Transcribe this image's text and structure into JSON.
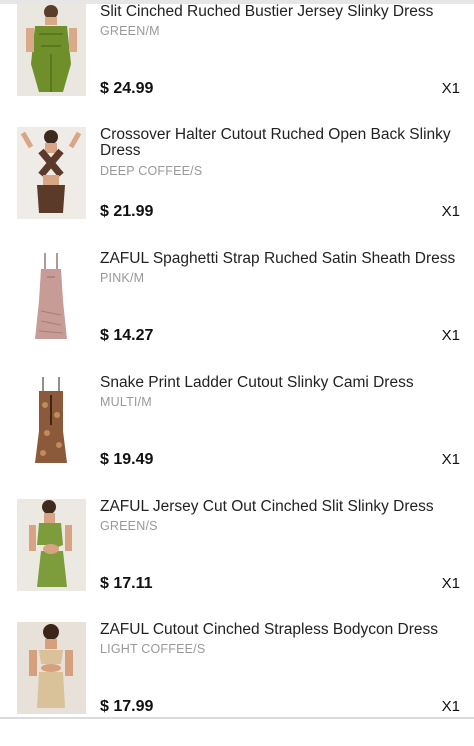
{
  "cart_items": [
    {
      "title": "Slit Cinched Ruched Bustier Jersey Slinky Dress",
      "variant": "GREEN/M",
      "price": "$ 24.99",
      "quantity": "X1",
      "image_color": "#6f8f2a"
    },
    {
      "title": "Crossover Halter Cutout Ruched Open Back Slinky Dress",
      "variant": "DEEP COFFEE/S",
      "price": "$ 21.99",
      "quantity": "X1",
      "image_color": "#5b3a2a"
    },
    {
      "title": "ZAFUL Spaghetti Strap Ruched Satin Sheath Dress",
      "variant": "PINK/M",
      "price": "$ 14.27",
      "quantity": "X1",
      "image_color": "#c89c96"
    },
    {
      "title": "Snake Print Ladder Cutout Slinky Cami Dress",
      "variant": "MULTI/M",
      "price": "$ 19.49",
      "quantity": "X1",
      "image_color": "#8a5a3a"
    },
    {
      "title": "ZAFUL Jersey Cut Out Cinched Slit Slinky Dress",
      "variant": "GREEN/S",
      "price": "$ 17.11",
      "quantity": "X1",
      "image_color": "#7d9d3c"
    },
    {
      "title": "ZAFUL Cutout Cinched Strapless Bodycon Dress",
      "variant": "LIGHT COFFEE/S",
      "price": "$ 17.99",
      "quantity": "X1",
      "image_color": "#d9c19a"
    }
  ]
}
